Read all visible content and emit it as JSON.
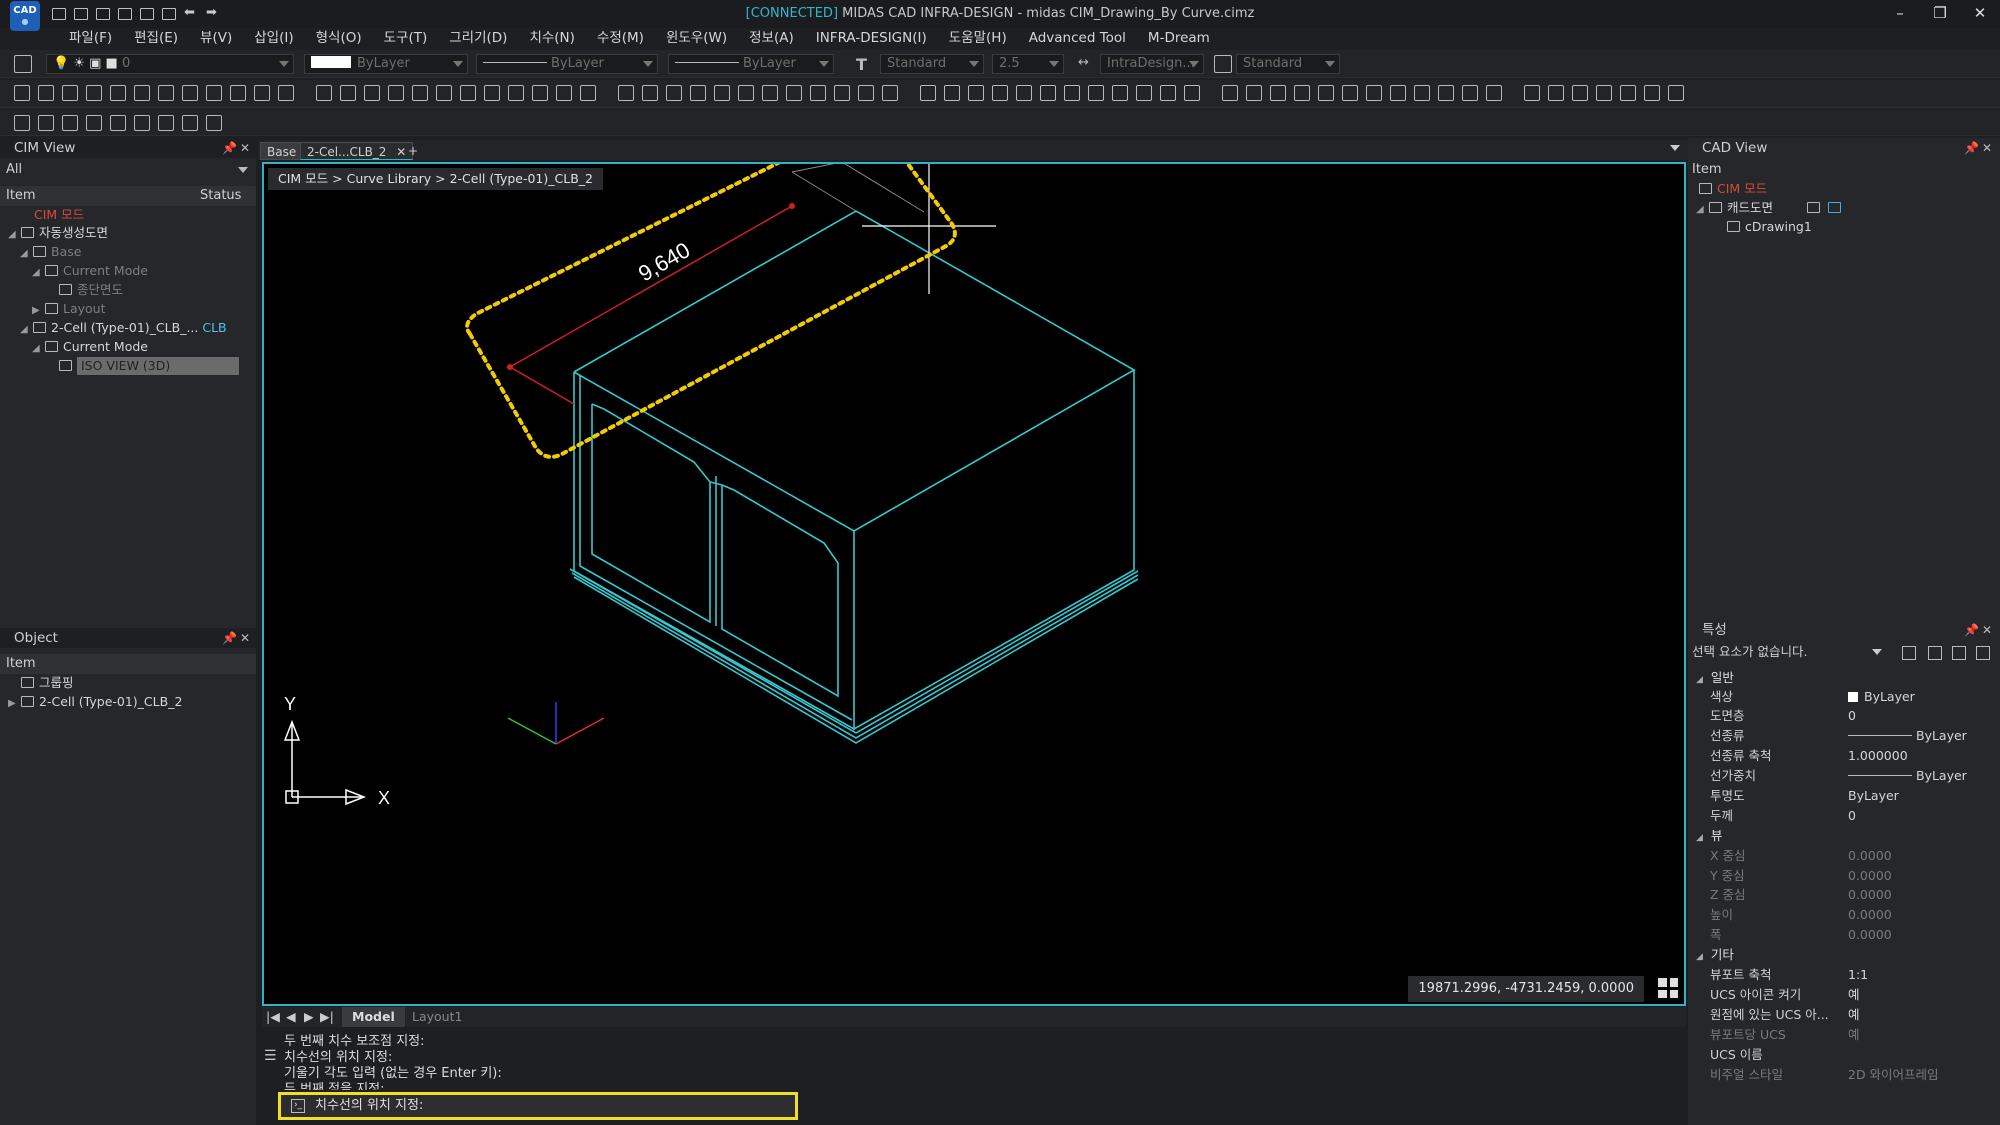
{
  "titlebar": {
    "logo_text": "CAD",
    "connected": "[CONNECTED]",
    "title_rest": " MIDAS CAD INFRA-DESIGN - midas CIM_Drawing_By Curve.cimz"
  },
  "menu": [
    "파일(F)",
    "편집(E)",
    "뷰(V)",
    "삽입(I)",
    "형식(O)",
    "도구(T)",
    "그리기(D)",
    "치수(N)",
    "수정(M)",
    "윈도우(W)",
    "정보(A)",
    "INFRA-DESIGN(I)",
    "도움말(H)",
    "Advanced Tool",
    "M-Dream"
  ],
  "toolbar": {
    "layer_value": "0",
    "color_value": "ByLayer",
    "linetype_value": "ByLayer",
    "lineweight_value": "ByLayer",
    "text_style": "Standard",
    "text_height": "2.5",
    "dim_style": "IntraDesign...",
    "table_style": "Standard"
  },
  "cim_view": {
    "title": "CIM View",
    "filter": "All",
    "col_item": "Item",
    "col_status": "Status",
    "tree": [
      {
        "label": "CIM 모드",
        "style": "red"
      },
      {
        "label": "자동생성도면",
        "style": "normal"
      },
      {
        "label": "Base",
        "style": "dim"
      },
      {
        "label": "Current Mode",
        "style": "dim"
      },
      {
        "label": "종단면도",
        "style": "dim"
      },
      {
        "label": "Layout",
        "style": "dim"
      },
      {
        "label": "2-Cell (Type-01)_CLB_...",
        "suffix": "CLB",
        "style": "normal"
      },
      {
        "label": "Current Mode",
        "style": "normal"
      },
      {
        "label": "ISO VIEW (3D)",
        "style": "selected"
      }
    ]
  },
  "object_panel": {
    "title": "Object",
    "col_item": "Item",
    "tree": [
      {
        "label": "그룹핑"
      },
      {
        "label": "2-Cell (Type-01)_CLB_2"
      }
    ]
  },
  "doc_tabs": [
    {
      "label": "Base",
      "active": false
    },
    {
      "label": "2-Cel...CLB_2",
      "active": true
    }
  ],
  "doc_tab_add": "+",
  "viewport": {
    "breadcrumb": "CIM 모드 > Curve Library > 2-Cell (Type-01)_CLB_2",
    "dimension_text": "9,640",
    "coords": "19871.2996, -4731.2459, 0.0000",
    "ucs_x": "X",
    "ucs_y": "Y",
    "wire_color": "#35c8d0",
    "dim_color": "#d02020",
    "highlight_color": "#f2cc00"
  },
  "layout_tabs": {
    "model": "Model",
    "layout1": "Layout1"
  },
  "command": {
    "history": [
      "두 번째 치수 보조점 지정:",
      "치수선의 위치 지정:",
      "기울기 각도 입력 (없는 경우 Enter 키):",
      "두 번째 점을 지정:"
    ],
    "prompt": "치수선의 위치 지정:"
  },
  "cad_view": {
    "title": "CAD View",
    "col_item": "Item",
    "tree": [
      {
        "label": "CIM 모드",
        "style": "red"
      },
      {
        "label": "캐드도면",
        "style": "normal"
      },
      {
        "label": "cDrawing1",
        "style": "normal"
      }
    ]
  },
  "properties": {
    "title": "특성",
    "selection": "선택 요소가 없습니다.",
    "sections": [
      {
        "name": "일반",
        "rows": [
          {
            "k": "색상",
            "v": "ByLayer",
            "swatch": true
          },
          {
            "k": "도면층",
            "v": "0"
          },
          {
            "k": "선종류",
            "v": "ByLayer",
            "line": true
          },
          {
            "k": "선종류 축척",
            "v": "1.000000"
          },
          {
            "k": "선가중치",
            "v": "ByLayer",
            "line": true
          },
          {
            "k": "투명도",
            "v": "ByLayer"
          },
          {
            "k": "두께",
            "v": "0"
          }
        ]
      },
      {
        "name": "뷰",
        "rows": [
          {
            "k": "X 중심",
            "v": "0.0000",
            "dim": true
          },
          {
            "k": "Y 중심",
            "v": "0.0000",
            "dim": true
          },
          {
            "k": "Z 중심",
            "v": "0.0000",
            "dim": true
          },
          {
            "k": "높이",
            "v": "0.0000",
            "dim": true
          },
          {
            "k": "폭",
            "v": "0.0000",
            "dim": true
          }
        ]
      },
      {
        "name": "기타",
        "rows": [
          {
            "k": "뷰포트 축척",
            "v": "1:1"
          },
          {
            "k": "UCS 아이콘 켜기",
            "v": "예"
          },
          {
            "k": "원점에 있는 UCS 아...",
            "v": "예"
          },
          {
            "k": "뷰포트당 UCS",
            "v": "예",
            "dim": true
          },
          {
            "k": "UCS 이름",
            "v": ""
          },
          {
            "k": "비주얼 스타일",
            "v": "2D 와이어프레임",
            "dim": true
          }
        ]
      }
    ]
  }
}
